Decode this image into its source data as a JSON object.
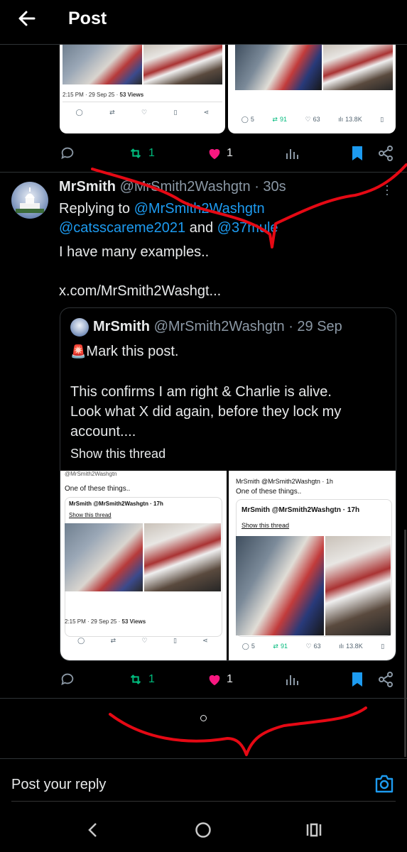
{
  "header": {
    "title": "Post"
  },
  "top_card": {
    "left": {
      "meta": "2:15 PM · 29 Sep 25 · ",
      "views": "53 Views"
    },
    "right": {
      "replies": "5",
      "reposts": "91",
      "likes": "63",
      "views": "13.8K"
    }
  },
  "top_actions": {
    "reposts": "1",
    "likes": "1"
  },
  "reply_post": {
    "name": "MrSmith",
    "handle": "@MrSmith2Washgtn",
    "time": "· 30s",
    "replying_prefix": "Replying to ",
    "replying_line1": "@MrSmith2Washgtn",
    "replying_line2a": "@catsscareme2021",
    "replying_and": " and ",
    "replying_line2b": "@37mule",
    "body": "I have many examples..",
    "link": "x.com/MrSmith2Washgt..."
  },
  "quote": {
    "name": "MrSmith",
    "handle": "@MrSmith2Washgtn",
    "time": "· 29 Sep",
    "emoji": "🚨",
    "line1": "Mark this post.",
    "line2": "This confirms I am right & Charlie is alive.",
    "line3": "Look what X did again, before they lock my",
    "line4": "account....",
    "show_thread": "Show this thread",
    "img_left": {
      "top_handle": "@MrSmith2Washgtn",
      "text": "One of these things..",
      "inner_author": "MrSmith @MrSmith2Washgtn · 17h",
      "inner_show": "Show this thread",
      "meta": "2:15 PM · 29 Sep 25 · ",
      "views": "53 Views"
    },
    "img_right": {
      "author": "MrSmith @MrSmith2Washgtn · 1h",
      "text": "One of these things..",
      "inner_author": "MrSmith @MrSmith2Washgtn · 17h",
      "inner_show": "Show this thread",
      "replies": "5",
      "reposts": "91",
      "likes": "63",
      "views": "13.8K"
    }
  },
  "reply_actions": {
    "reposts": "1",
    "likes": "1"
  },
  "composer": {
    "placeholder": "Post your reply"
  },
  "colors": {
    "accent": "#1d9bf0",
    "repost": "#00ba7c",
    "like": "#f91880",
    "annotation": "#e50914"
  }
}
